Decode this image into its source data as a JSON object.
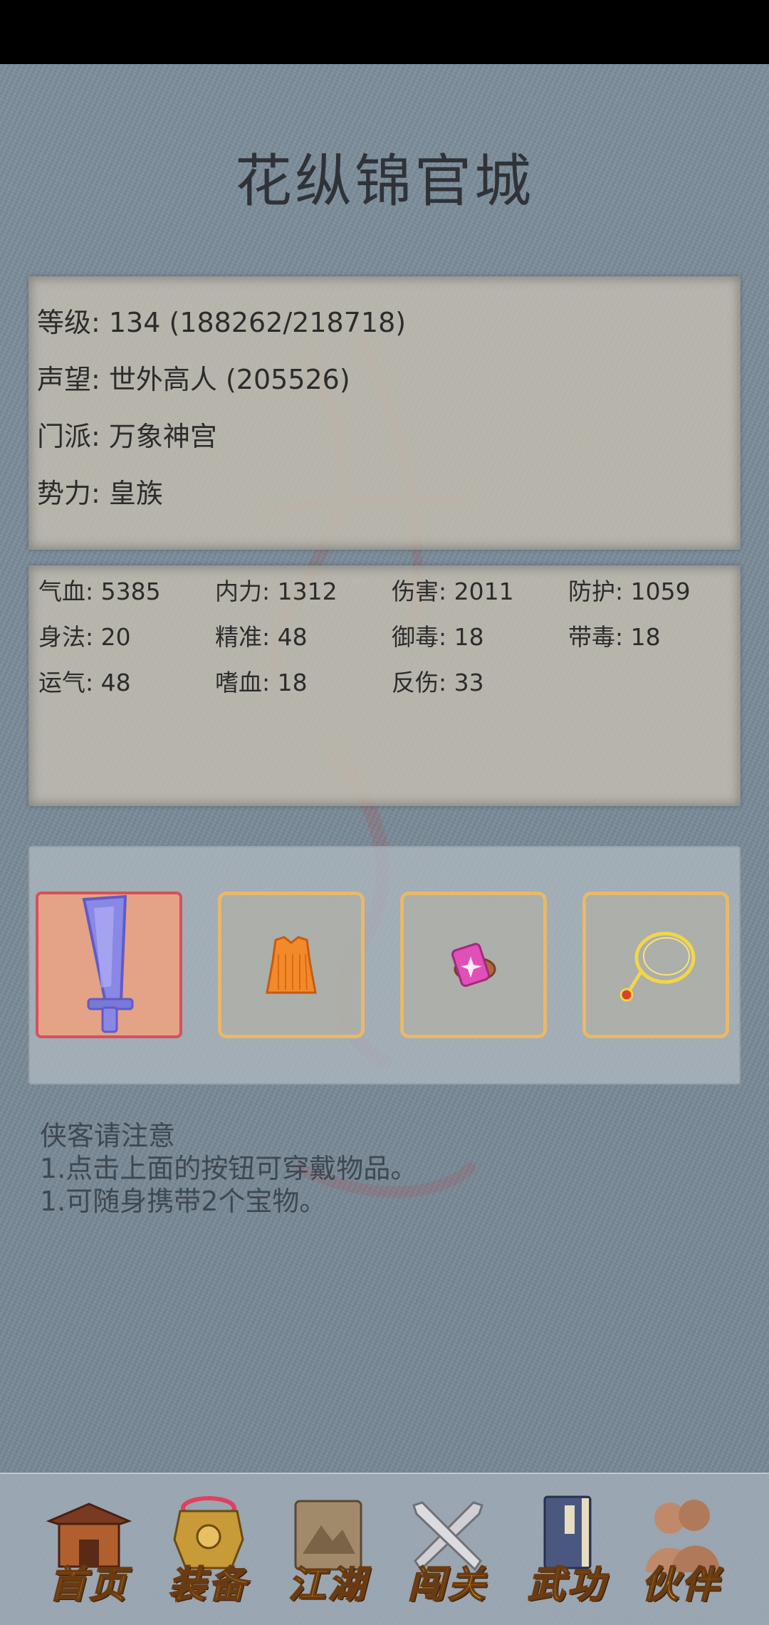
{
  "title": "花纵锦官城",
  "info": {
    "level": "等级: 134 (188262/218718)",
    "reputation": "声望: 世外高人 (205526)",
    "sect": "门派: 万象神宫",
    "faction": "势力:  皇族"
  },
  "stats": [
    [
      "气血: 5385",
      "内力: 1312",
      "伤害: 2011",
      "防护: 1059"
    ],
    [
      "身法: 20",
      "精准: 48",
      "御毒: 18",
      "带毒: 18"
    ],
    [
      "运气: 48",
      "嗜血: 18",
      "反伤: 33"
    ]
  ],
  "equipment": [
    {
      "icon": "sword-icon",
      "selected": true
    },
    {
      "icon": "robe-icon",
      "selected": false
    },
    {
      "icon": "gem-icon",
      "selected": false
    },
    {
      "icon": "necklace-icon",
      "selected": false
    }
  ],
  "notes": {
    "heading": "侠客请注意",
    "line1": "1.点击上面的按钮可穿戴物品。",
    "line2": "1.可随身携带2个宝物。"
  },
  "nav": {
    "home": "首页",
    "equip": "装备",
    "jianghu": "江湖",
    "stage": "闯关",
    "martial": "武功",
    "partner": "伙伴"
  },
  "colors": {
    "accent_gold": "#f4b526",
    "slot_border": "#e9b86a",
    "selected_border": "#d8505a"
  }
}
